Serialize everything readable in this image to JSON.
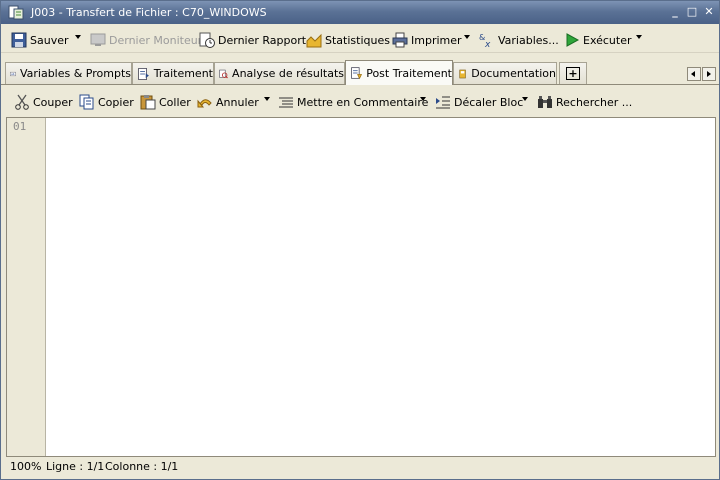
{
  "window": {
    "title": "J003 - Transfert de Fichier : C70_WINDOWS",
    "minimize": "_",
    "maximize": "□",
    "close": "✕"
  },
  "toolbar_main": {
    "save": "Sauver",
    "last_monitor": "Dernier Moniteur",
    "last_report": "Dernier Rapport",
    "statistics": "Statistiques",
    "print": "Imprimer",
    "variables": "Variables...",
    "execute": "Exécuter"
  },
  "tabs": {
    "variables_prompts": "Variables & Prompts",
    "processing": "Traitement",
    "results_analysis": "Analyse de résultats",
    "post_processing": "Post Traitement",
    "documentation": "Documentation",
    "add": "+"
  },
  "toolbar_edit": {
    "cut": "Couper",
    "copy": "Copier",
    "paste": "Coller",
    "undo": "Annuler",
    "comment": "Mettre en Commentaire",
    "indent": "Décaler Bloc",
    "search": "Rechercher ..."
  },
  "editor": {
    "line_numbers": [
      "01"
    ]
  },
  "status": {
    "zoom": "100%",
    "line": "Ligne : 1/1",
    "column": "Colonne : 1/1"
  }
}
